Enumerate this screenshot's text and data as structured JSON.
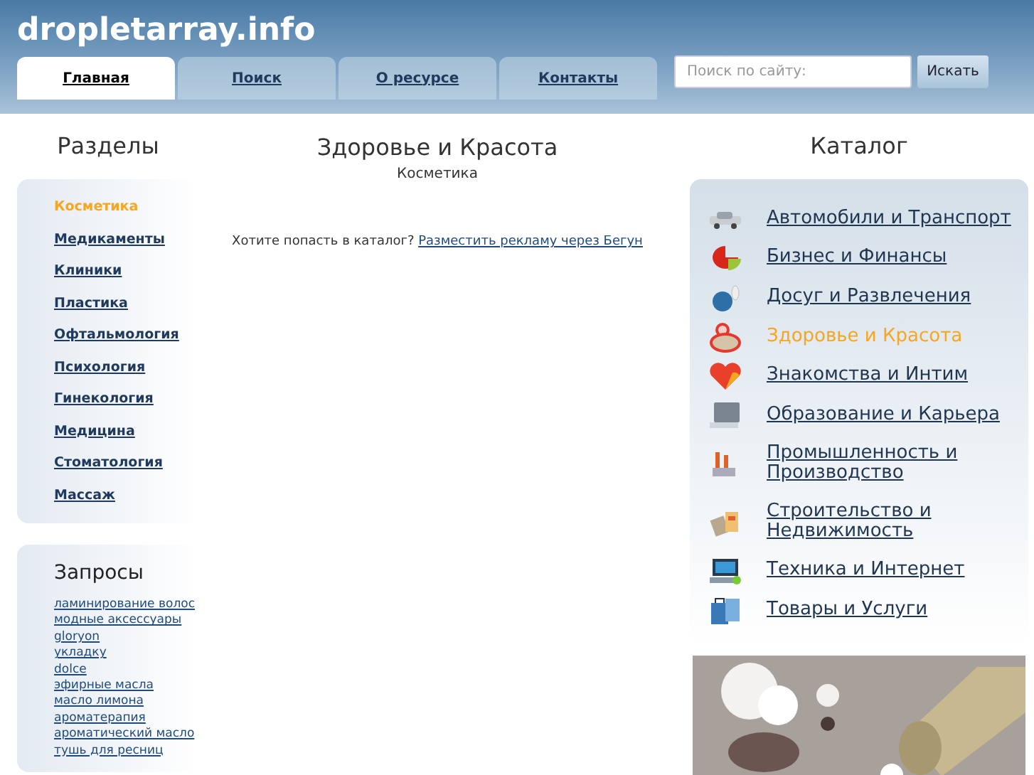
{
  "site": {
    "logo": "dropletarray.info"
  },
  "tabs": [
    {
      "label": "Главная",
      "selected": true
    },
    {
      "label": "Поиск",
      "selected": false
    },
    {
      "label": "О ресурсе",
      "selected": false
    },
    {
      "label": "Контакты",
      "selected": false
    }
  ],
  "search": {
    "placeholder": "Поиск по сайту:",
    "button": "Искать"
  },
  "sections": {
    "title": "Разделы",
    "items": [
      {
        "label": "Косметика",
        "selected": true
      },
      {
        "label": "Медикаменты",
        "selected": false
      },
      {
        "label": "Клиники",
        "selected": false
      },
      {
        "label": "Пластика",
        "selected": false
      },
      {
        "label": "Офтальмология",
        "selected": false
      },
      {
        "label": "Психология",
        "selected": false
      },
      {
        "label": "Гинекология",
        "selected": false
      },
      {
        "label": "Медицина",
        "selected": false
      },
      {
        "label": "Стоматология",
        "selected": false
      },
      {
        "label": "Массаж",
        "selected": false
      }
    ]
  },
  "queries": {
    "title": "Запросы",
    "items": [
      "ламинирование волос",
      "модные аксессуары",
      "gloryon",
      "укладку",
      "dolce",
      "эфирные масла",
      "масло лимона",
      "ароматерапия",
      "ароматический масло",
      "тушь для ресниц"
    ]
  },
  "main": {
    "title": "Здоровье и Красота",
    "subtitle": "Косметика",
    "prompt": "Хотите попасть в каталог?",
    "link": "Разместить рекламу через Бегун"
  },
  "catalog": {
    "title": "Каталог",
    "items": [
      {
        "label": "Автомобили и Транспорт",
        "selected": false
      },
      {
        "label": "Бизнес и Финансы",
        "selected": false
      },
      {
        "label": "Досуг и Развлечения",
        "selected": false
      },
      {
        "label": "Здоровье и Красота",
        "selected": true
      },
      {
        "label": "Знакомства и Интим",
        "selected": false
      },
      {
        "label": "Образование и Карьера",
        "selected": false
      },
      {
        "label": "Промышленность и Производство",
        "selected": false
      },
      {
        "label": "Строительство и Недвижимость",
        "selected": false
      },
      {
        "label": "Техника и Интернет",
        "selected": false
      },
      {
        "label": "Товары и Услуги",
        "selected": false
      }
    ]
  }
}
